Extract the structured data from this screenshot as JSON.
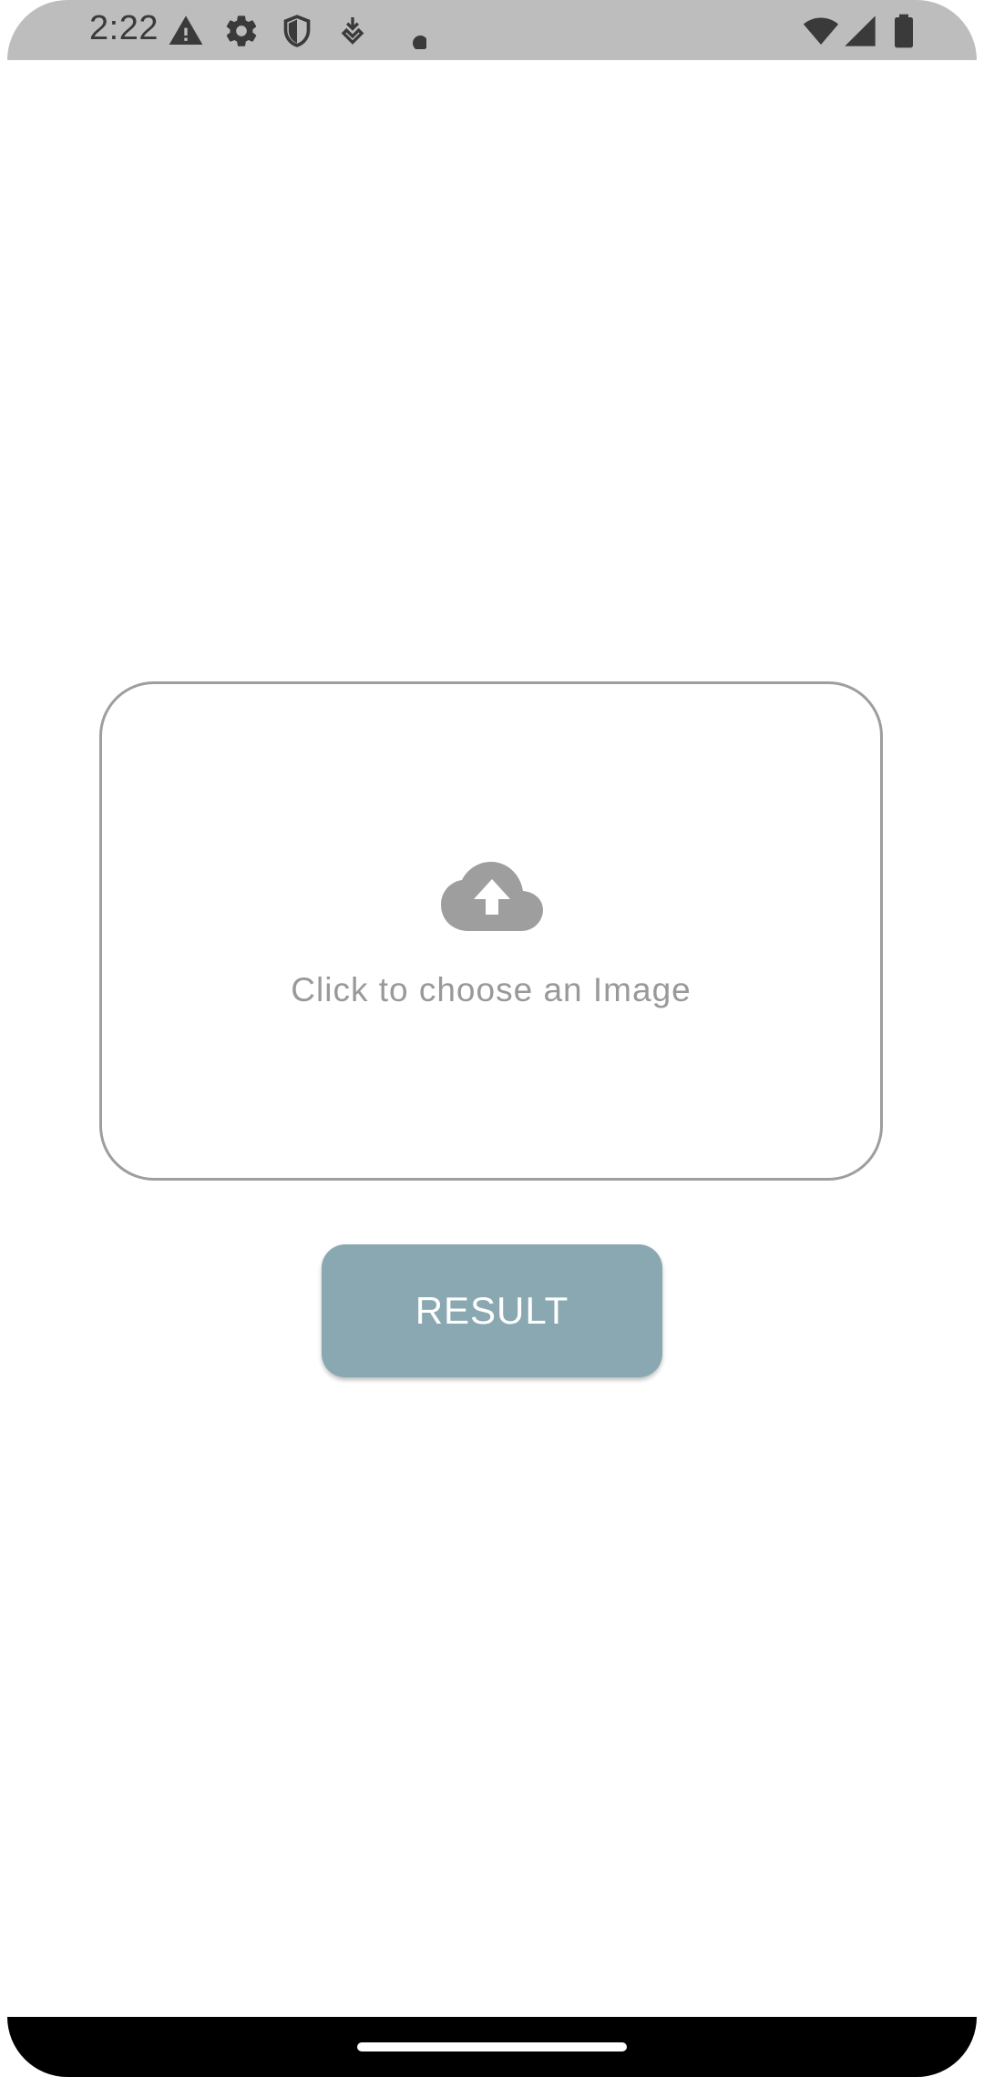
{
  "status_bar": {
    "time": "2:22",
    "icons_left": [
      "warning-icon",
      "settings-icon",
      "shield-icon",
      "download-icon",
      "dot-icon"
    ],
    "icons_right": [
      "wifi-icon",
      "signal-icon",
      "battery-icon"
    ],
    "background": "#bdbdbd"
  },
  "upload": {
    "label": "Click to choose an Image",
    "icon": "cloud-upload-icon",
    "border_color": "#9e9e9e",
    "text_color": "#999999"
  },
  "result_button": {
    "label": "RESULT",
    "color": "#8aa8b1"
  }
}
